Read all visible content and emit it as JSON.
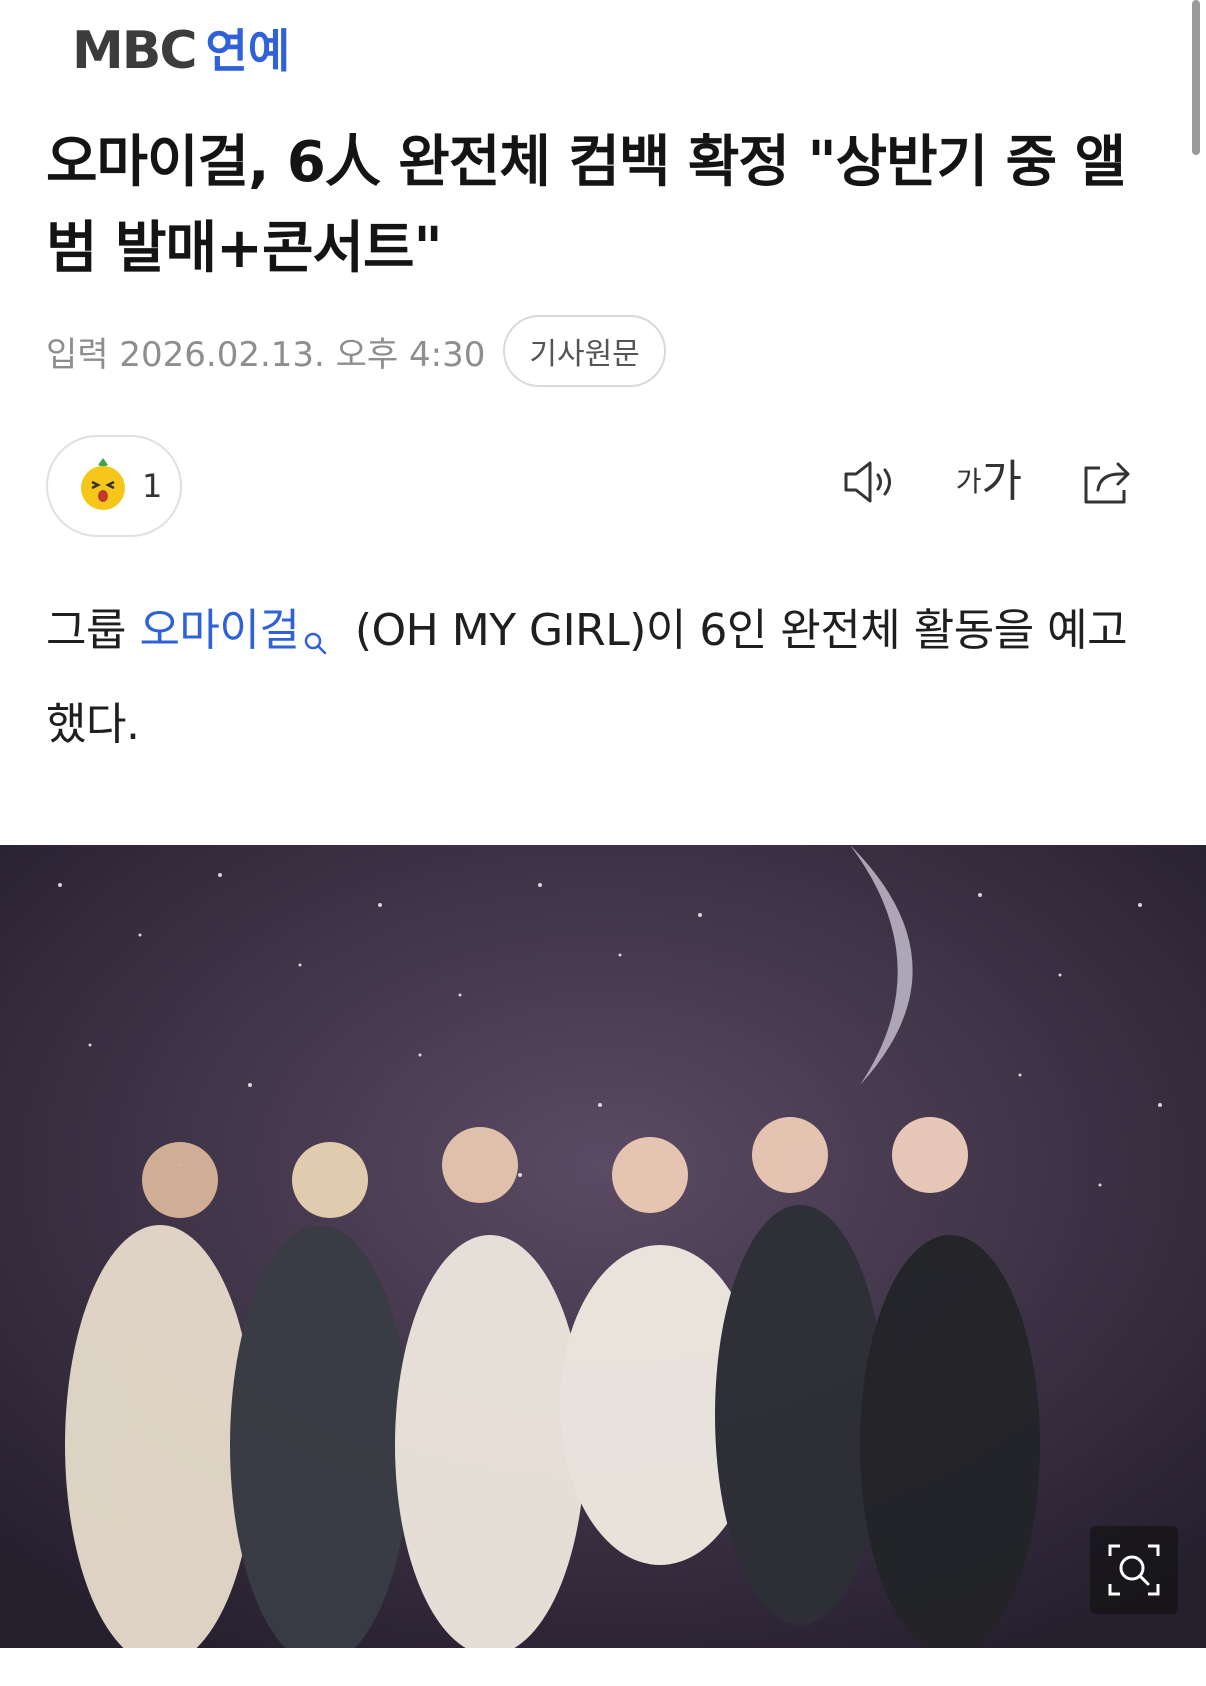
{
  "header": {
    "logo_mbc": "MBC",
    "logo_section": "연예"
  },
  "article": {
    "title": "오마이걸, 6人 완전체 컴백 확정 \"상반기 중 앨범 발매+콘서트\"",
    "date": "입력 2026.02.13. 오후 4:30",
    "original_label": "기사원문",
    "reaction_count": "1",
    "body": {
      "before": "그룹 ",
      "keyword": "오마이걸",
      "after": " (OH MY GIRL)이 6인 완전체 활동을 예고했다."
    }
  },
  "toolbar": {
    "font_small": "가",
    "font_large": "가"
  },
  "icons": [
    "speaker-icon",
    "font-size-icon",
    "share-icon",
    "search-icon",
    "zoom-icon",
    "reaction-emoji-icon"
  ],
  "colors": {
    "accent": "#2f62d8",
    "meta_text": "#8e8e8e"
  }
}
